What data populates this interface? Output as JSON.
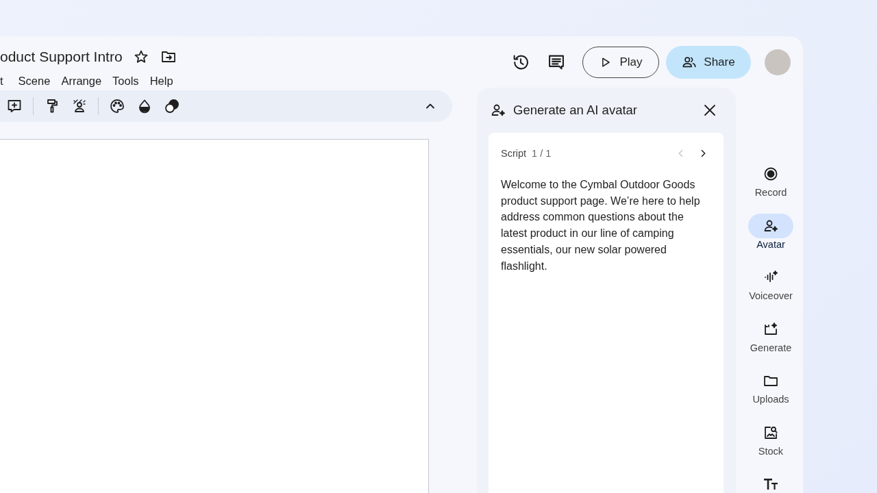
{
  "document": {
    "title": "oduct Support Intro"
  },
  "menu": [
    "t",
    "Scene",
    "Arrange",
    "Tools",
    "Help"
  ],
  "header_buttons": {
    "play": "Play",
    "share": "Share"
  },
  "panel": {
    "title": "Generate an AI avatar",
    "script_label": "Script",
    "script_counter": "1 / 1",
    "previous_disabled": true,
    "next_disabled": false,
    "script_text": "Welcome to the Cymbal Outdoor Goods product support page. We’re here to help address common questions about the latest product in our line of camping essentials, our new solar powered flashlight."
  },
  "rail": [
    {
      "kind": "record",
      "label": "Record",
      "selected": false
    },
    {
      "kind": "avatar",
      "label": "Avatar",
      "selected": true
    },
    {
      "kind": "voiceover",
      "label": "Voiceover",
      "selected": false
    },
    {
      "kind": "generate",
      "label": "Generate",
      "selected": false
    },
    {
      "kind": "uploads",
      "label": "Uploads",
      "selected": false
    },
    {
      "kind": "stock",
      "label": "Stock",
      "selected": false
    },
    {
      "kind": "text",
      "selected": false
    }
  ]
}
